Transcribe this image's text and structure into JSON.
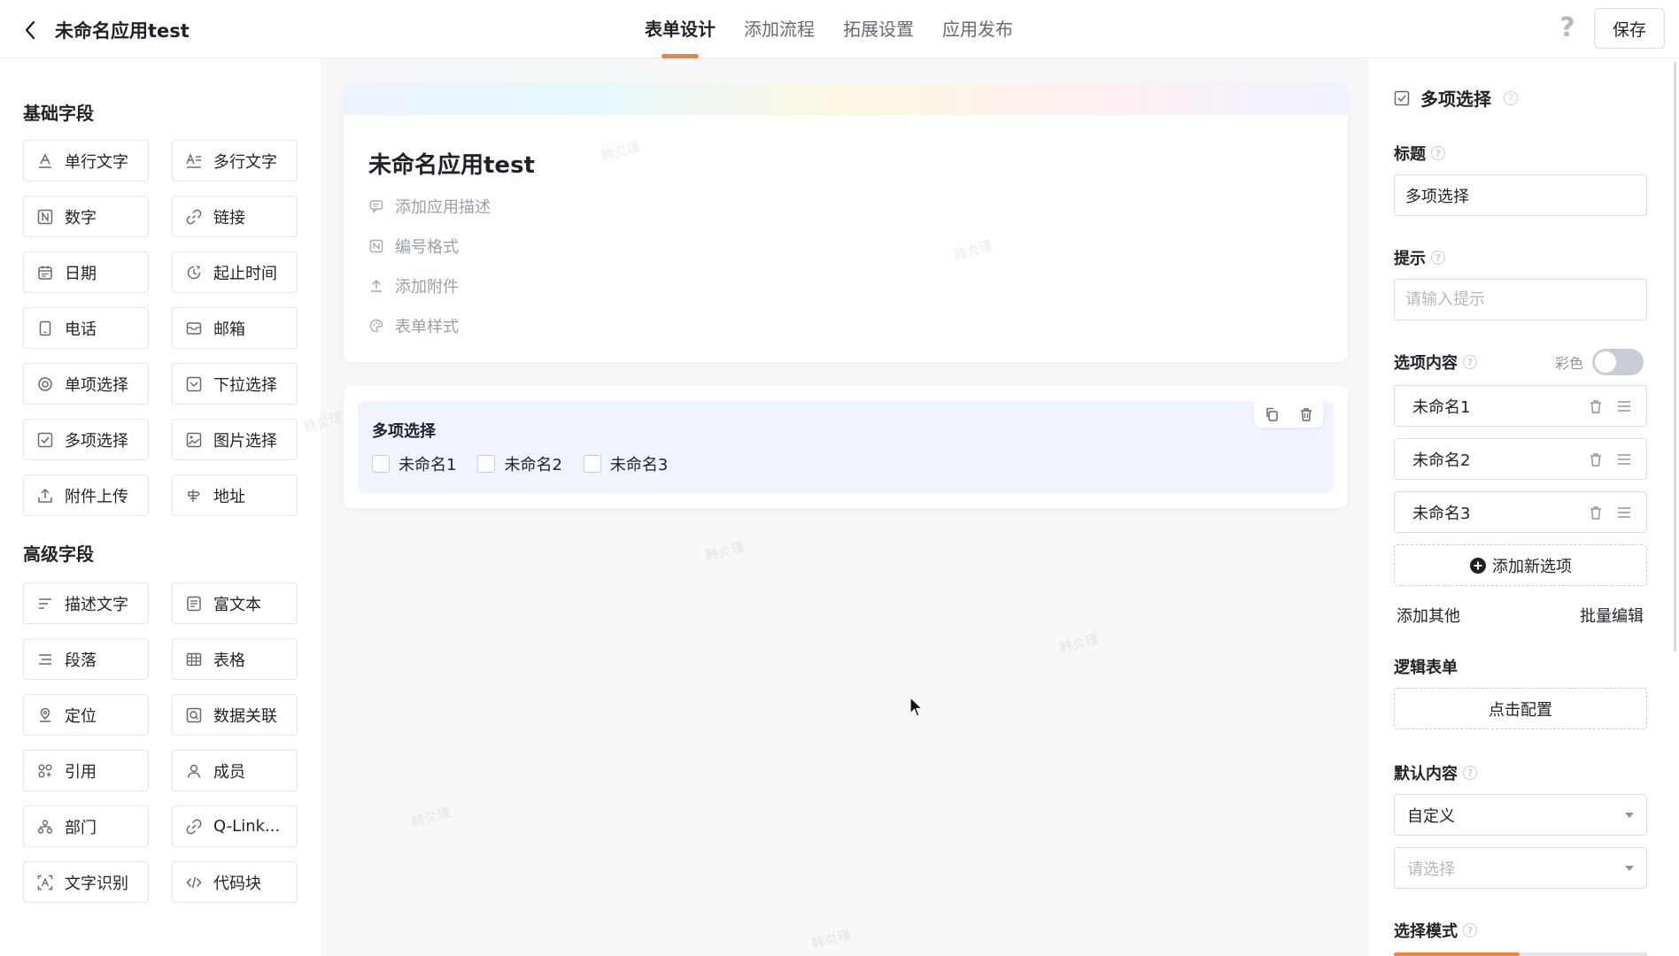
{
  "header": {
    "app_title": "未命名应用test",
    "tabs": [
      {
        "label": "表单设计",
        "active": true
      },
      {
        "label": "添加流程",
        "active": false
      },
      {
        "label": "拓展设置",
        "active": false
      },
      {
        "label": "应用发布",
        "active": false
      }
    ],
    "help_glyph": "?",
    "save_label": "保存",
    "accent_color": "#f0833a"
  },
  "palette": {
    "basic_title": "基础字段",
    "basic_fields": [
      {
        "label": "单行文字",
        "icon": "text-line-icon"
      },
      {
        "label": "多行文字",
        "icon": "text-multiline-icon"
      },
      {
        "label": "数字",
        "icon": "number-icon"
      },
      {
        "label": "链接",
        "icon": "link-icon"
      },
      {
        "label": "日期",
        "icon": "calendar-icon"
      },
      {
        "label": "起止时间",
        "icon": "time-range-icon"
      },
      {
        "label": "电话",
        "icon": "phone-icon"
      },
      {
        "label": "邮箱",
        "icon": "mail-icon"
      },
      {
        "label": "单项选择",
        "icon": "radio-icon"
      },
      {
        "label": "下拉选择",
        "icon": "dropdown-icon"
      },
      {
        "label": "多项选择",
        "icon": "checkbox-icon"
      },
      {
        "label": "图片选择",
        "icon": "image-icon"
      },
      {
        "label": "附件上传",
        "icon": "upload-icon"
      },
      {
        "label": "地址",
        "icon": "address-icon"
      }
    ],
    "advanced_title": "高级字段",
    "advanced_fields": [
      {
        "label": "描述文字",
        "icon": "description-icon"
      },
      {
        "label": "富文本",
        "icon": "rich-text-icon"
      },
      {
        "label": "段落",
        "icon": "paragraph-icon"
      },
      {
        "label": "表格",
        "icon": "table-icon"
      },
      {
        "label": "定位",
        "icon": "location-icon"
      },
      {
        "label": "数据关联",
        "icon": "data-link-icon"
      },
      {
        "label": "引用",
        "icon": "reference-icon"
      },
      {
        "label": "成员",
        "icon": "member-icon"
      },
      {
        "label": "部门",
        "icon": "department-icon"
      },
      {
        "label": "Q-Link...",
        "icon": "qlink-icon"
      },
      {
        "label": "文字识别",
        "icon": "ocr-icon"
      },
      {
        "label": "代码块",
        "icon": "code-icon"
      }
    ]
  },
  "canvas": {
    "form_title": "未命名应用test",
    "meta_items": [
      {
        "label": "添加应用描述",
        "icon": "comment-icon"
      },
      {
        "label": "编号格式",
        "icon": "number-format-icon"
      },
      {
        "label": "添加附件",
        "icon": "attachment-icon"
      },
      {
        "label": "表单样式",
        "icon": "palette-icon"
      }
    ],
    "field": {
      "title": "多项选择",
      "options": [
        "未命名1",
        "未命名2",
        "未命名3"
      ]
    },
    "watermark": "韩炎瑾"
  },
  "properties": {
    "type_title": "多项选择",
    "title_label": "标题",
    "title_value": "多项选择",
    "hint_label": "提示",
    "hint_placeholder": "请输入提示",
    "options_label": "选项内容",
    "color_label": "彩色",
    "color_enabled": false,
    "options": [
      "未命名1",
      "未命名2",
      "未命名3"
    ],
    "add_option_label": "添加新选项",
    "add_other_label": "添加其他",
    "batch_edit_label": "批量编辑",
    "logic_label": "逻辑表单",
    "logic_button": "点击配置",
    "default_label": "默认内容",
    "default_mode": "自定义",
    "default_placeholder": "请选择",
    "select_mode_label": "选择模式"
  }
}
